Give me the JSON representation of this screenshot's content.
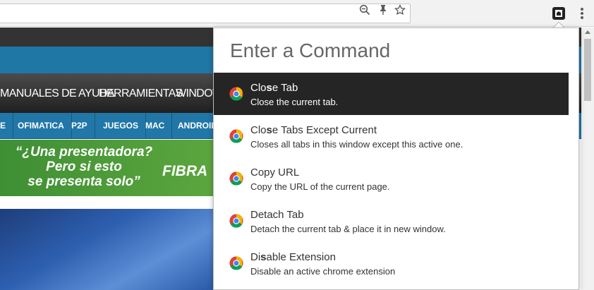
{
  "browser": {
    "omnibox_value": "",
    "toolbar_icons": [
      "zoom-out-icon",
      "pin-icon",
      "star-icon"
    ],
    "extension_icon": "command-palette-extension-icon",
    "menu_icon": "kebab-menu-icon"
  },
  "website": {
    "nav_items": [
      "MANUALES DE AYUDA",
      "HERRAMIENTAS",
      "WINDOWS"
    ],
    "sub_nav_items": [
      "E",
      "OFIMATICA",
      "P2P",
      "JUEGOS",
      "MAC",
      "ANDROID"
    ],
    "banner": {
      "line1": "“¿Una presentadora?",
      "line2": "Pero si esto",
      "line3": "se presenta solo”",
      "brand": "FIBRA"
    }
  },
  "command_palette": {
    "input_placeholder": "Enter a Command",
    "input_value": "",
    "highlight_char": "s",
    "items": [
      {
        "title_pre": "Clo",
        "title_match": "s",
        "title_post": "e Tab",
        "description": "Close the current tab.",
        "icon": "chrome-icon",
        "selected": true
      },
      {
        "title_pre": "Clo",
        "title_match": "s",
        "title_post": "e Tabs Except Current",
        "description": "Closes all tabs in this window except this active one.",
        "icon": "chrome-icon",
        "selected": false
      },
      {
        "title_pre": "Copy URL",
        "title_match": "",
        "title_post": "",
        "description": "Copy the URL of the current page.",
        "icon": "chrome-icon",
        "selected": false
      },
      {
        "title_pre": "Detach Tab",
        "title_match": "",
        "title_post": "",
        "description": "Detach the current tab & place it in new window.",
        "icon": "chrome-icon",
        "selected": false
      },
      {
        "title_pre": "Di",
        "title_match": "s",
        "title_post": "able Extension",
        "description": "Disable an active chrome extension",
        "icon": "chrome-icon",
        "selected": false
      }
    ]
  },
  "colors": {
    "selected_row": "#252525",
    "site_blue": "#1f77a6",
    "site_nav_dark": "#2e2e2e",
    "banner_green": "#4a9a38"
  }
}
